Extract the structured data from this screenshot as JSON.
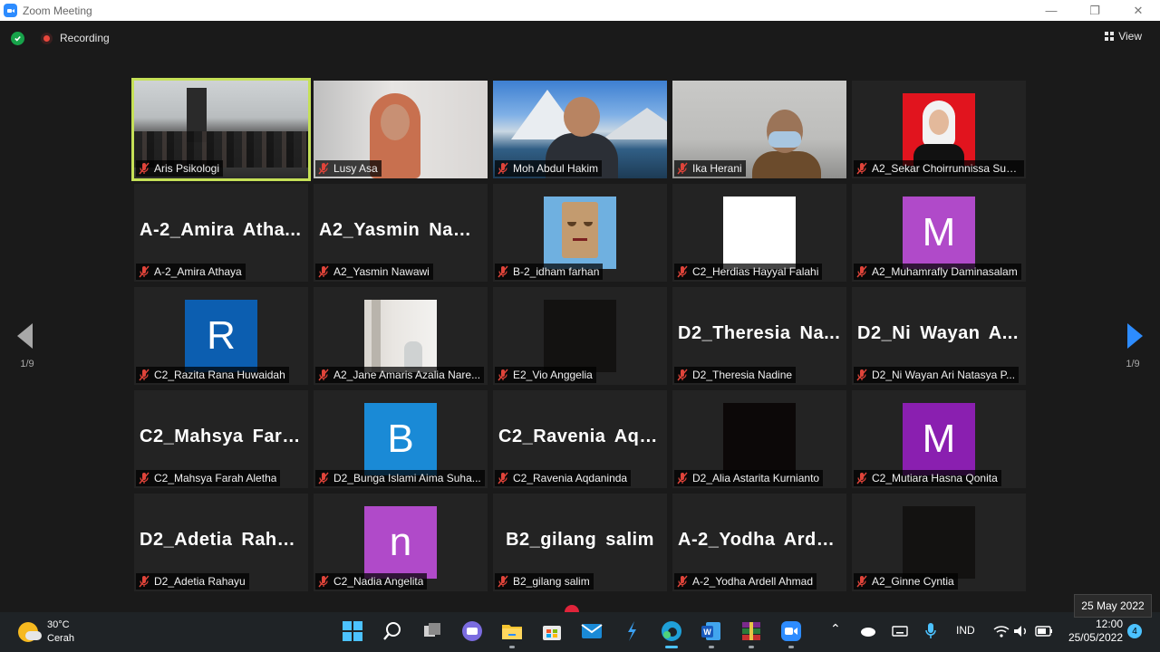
{
  "window": {
    "title": "Zoom Meeting"
  },
  "meeting_bar": {
    "recording_label": "Recording",
    "view_label": "View"
  },
  "pagination": {
    "left_page": "1/9",
    "right_page": "1/9"
  },
  "tiles": [
    {
      "name": "Aris Psikologi",
      "kind": "video-room",
      "active": true
    },
    {
      "name": "Lusy Asa",
      "kind": "video-lusy"
    },
    {
      "name": "Moh Abdul Hakim",
      "kind": "video-mountain"
    },
    {
      "name": "Ika Herani",
      "kind": "video-ika"
    },
    {
      "name": "A2_Sekar Choirrunnissa Sup...",
      "kind": "photo-sekar"
    },
    {
      "name": "A-2_Amira Athaya",
      "big": "A-2_Amira  Atha...",
      "kind": "text"
    },
    {
      "name": "A2_Yasmin Nawawi",
      "big": "A2_Yasmin  Naw...",
      "kind": "text"
    },
    {
      "name": "B-2_idham farhan",
      "kind": "photo-paperbag"
    },
    {
      "name": "C2_Herdias Hayyal Falahi",
      "kind": "photo-white"
    },
    {
      "name": "A2_Muhamrafly Daminasalam",
      "kind": "letter",
      "letter": "M",
      "color": "#b04ac9"
    },
    {
      "name": "C2_Razita Rana Huwaidah",
      "kind": "letter",
      "letter": "R",
      "color": "#0c5eb0"
    },
    {
      "name": "A2_Jane Amaris Azalia Nare...",
      "kind": "photo-room"
    },
    {
      "name": "E2_Vio Anggelia",
      "kind": "photo-dark"
    },
    {
      "name": "D2_Theresia Nadine",
      "big": "D2_Theresia  Na...",
      "kind": "text"
    },
    {
      "name": "D2_Ni Wayan Ari Natasya P...",
      "big": "D2_Ni  Wayan  A...",
      "kind": "text"
    },
    {
      "name": "C2_Mahsya Farah Aletha",
      "big": "C2_Mahsya  Fara...",
      "kind": "text"
    },
    {
      "name": "D2_Bunga Islami Aima Suha...",
      "kind": "letter",
      "letter": "B",
      "color": "#1a8ad6"
    },
    {
      "name": "C2_Ravenia Aqdaninda",
      "big": "C2_Ravenia  Aqd...",
      "kind": "text"
    },
    {
      "name": "D2_Alia Astarita Kurnianto",
      "kind": "photo-black"
    },
    {
      "name": "C2_Mutiara Hasna Qonita",
      "kind": "letter",
      "letter": "M",
      "color": "#8a1fb0"
    },
    {
      "name": "D2_Adetia Rahayu",
      "big": "D2_Adetia  Raha...",
      "kind": "text"
    },
    {
      "name": "C2_Nadia Angelita",
      "kind": "letter",
      "letter": "n",
      "color": "#b04ac9"
    },
    {
      "name": "B2_gilang salim",
      "big": "B2_gilang salim",
      "kind": "text",
      "center": true
    },
    {
      "name": "A-2_Yodha Ardell Ahmad",
      "big": "A-2_Yodha  Arde...",
      "kind": "text"
    },
    {
      "name": "A2_Ginne Cyntia",
      "kind": "photo-dark"
    }
  ],
  "taskbar": {
    "weather_temp": "30°C",
    "weather_desc": "Cerah",
    "icons": [
      "start-icon",
      "search-icon",
      "task-view-icon",
      "chat-icon",
      "file-explorer-icon",
      "store-icon",
      "mail-icon",
      "vscode-icon",
      "edge-icon",
      "word-icon",
      "winrar-icon",
      "zoom-icon"
    ],
    "language": "IND",
    "time": "12:00",
    "date": "25/05/2022",
    "tooltip_date": "25 May 2022",
    "notification_count": "4"
  }
}
